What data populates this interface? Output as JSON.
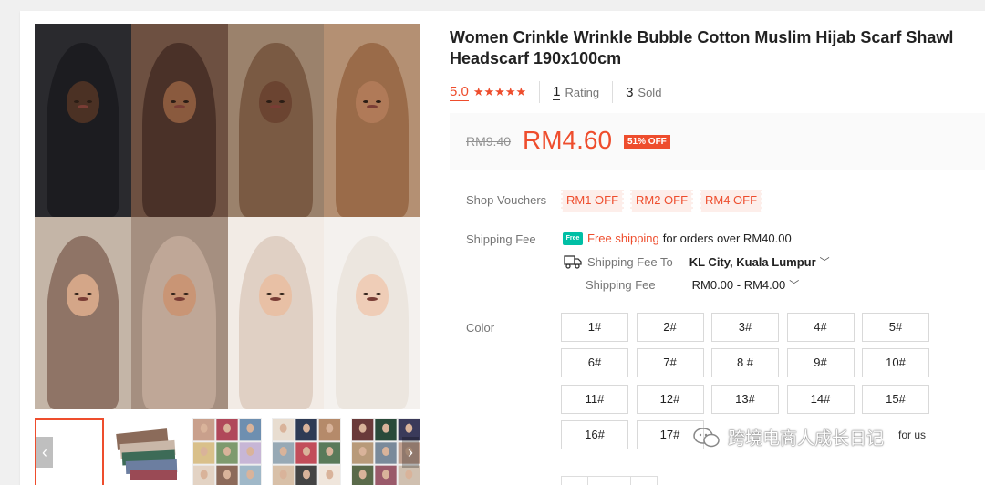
{
  "product": {
    "title": "Women Crinkle Wrinkle Bubble Cotton Muslim Hijab Scarf Shawl Headscarf 190x100cm",
    "rating": "5.0",
    "stars": "★★★★★",
    "rating_count": "1",
    "rating_label": "Rating",
    "sold_count": "3",
    "sold_label": "Sold"
  },
  "price": {
    "original": "RM9.40",
    "current": "RM4.60",
    "discount": "51% OFF"
  },
  "vouchers": {
    "label": "Shop Vouchers",
    "items": [
      "RM1 OFF",
      "RM2 OFF",
      "RM4 OFF"
    ]
  },
  "shipping": {
    "label": "Shipping Fee",
    "free_badge": "Free",
    "free_text": "Free shipping",
    "free_condition": "for orders over RM40.00",
    "to_label": "Shipping Fee To",
    "to_value": "KL City, Kuala Lumpur",
    "fee_label": "Shipping Fee",
    "fee_value": "RM0.00 - RM4.00"
  },
  "color": {
    "label": "Color",
    "options": [
      "1#",
      "2#",
      "3#",
      "4#",
      "5#",
      "6#",
      "7#",
      "8 #",
      "9#",
      "10#",
      "11#",
      "12#",
      "13#",
      "14#",
      "15#",
      "16#",
      "17#"
    ]
  },
  "gallery": {
    "tile_colors": [
      "#1c1c20",
      "#4a3128",
      "#7a5a43",
      "#9a6b49",
      "#8f7466",
      "#bfa797",
      "#e0d0c4",
      "#ece6df"
    ],
    "skin_tones": [
      "#4b3124",
      "#8a5a3e",
      "#6b4431",
      "#b07a58",
      "#d4a688",
      "#c99575",
      "#e8c0a5",
      "#efcdb7"
    ],
    "backgrounds": [
      "#2a2a2e",
      "#6d5041",
      "#9b826c",
      "#b49073",
      "#c4b5a7",
      "#a58f80",
      "#f2ebe5",
      "#f4f1ee"
    ],
    "thumb_prev": "‹",
    "thumb_next": "›"
  },
  "watermark": {
    "text": "跨境电商人成长日记",
    "cover_text": "for us"
  }
}
